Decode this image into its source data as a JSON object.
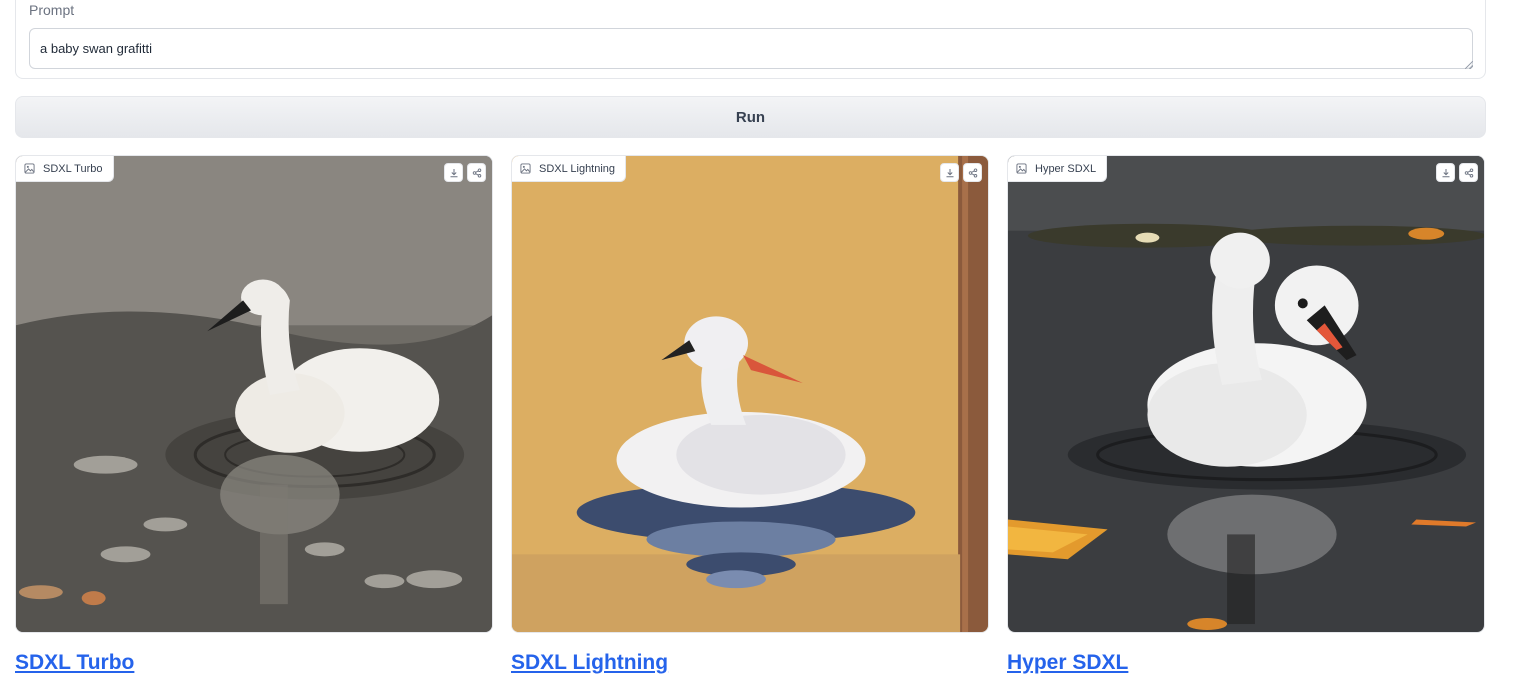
{
  "prompt": {
    "label": "Prompt",
    "value": "a baby swan grafitti"
  },
  "run_button": {
    "label": "Run"
  },
  "outputs": [
    {
      "badge": "SDXL Turbo",
      "link": "SDXL Turbo"
    },
    {
      "badge": "SDXL Lightning",
      "link": "SDXL Lightning"
    },
    {
      "badge": "Hyper SDXL",
      "link": "Hyper SDXL"
    }
  ],
  "icons": {
    "badge": "image-icon",
    "download": "download-icon",
    "share": "share-icon"
  },
  "colors": {
    "link": "#2563eb",
    "border": "#e5e7eb"
  }
}
